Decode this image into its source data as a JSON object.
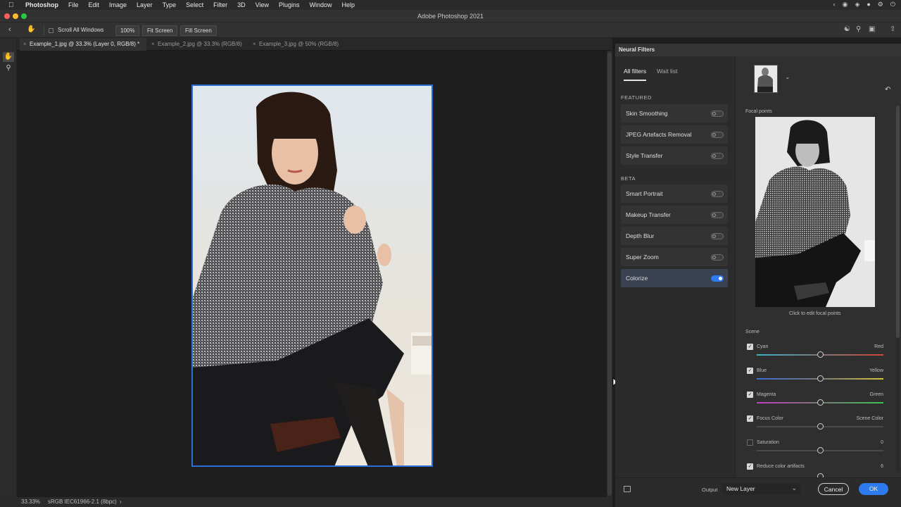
{
  "menubar": {
    "app": "Photoshop",
    "items": [
      "File",
      "Edit",
      "Image",
      "Layer",
      "Type",
      "Select",
      "Filter",
      "3D",
      "View",
      "Plugins",
      "Window",
      "Help"
    ]
  },
  "window": {
    "title": "Adobe Photoshop 2021"
  },
  "options": {
    "scroll_all_windows": "Scroll All Windows",
    "zoom_100": "100%",
    "fit_screen": "Fit Screen",
    "fill_screen": "Fill Screen"
  },
  "tabs": [
    {
      "label": "Example_1.jpg @ 33.3% (Layer 0, RGB/8) *"
    },
    {
      "label": "Example_2.jpg @ 33.3% (RGB/8)"
    },
    {
      "label": "Example_3.jpg @ 50% (RGB/8)"
    }
  ],
  "status": {
    "zoom": "33.33%",
    "profile": "sRGB IEC61966-2.1 (8bpc)"
  },
  "neural_filters": {
    "title": "Neural Filters",
    "tab_all": "All filters",
    "tab_wait": "Wait list",
    "featured_heading": "FEATURED",
    "beta_heading": "BETA",
    "featured": [
      {
        "label": "Skin Smoothing",
        "on": false
      },
      {
        "label": "JPEG Artefacts Removal",
        "on": false
      },
      {
        "label": "Style Transfer",
        "on": false
      }
    ],
    "beta": [
      {
        "label": "Smart Portrait",
        "on": false
      },
      {
        "label": "Makeup Transfer",
        "on": false
      },
      {
        "label": "Depth Blur",
        "on": false
      },
      {
        "label": "Super Zoom",
        "on": false
      },
      {
        "label": "Colorize",
        "on": true
      }
    ],
    "focal_points_label": "Focal points",
    "focal_hint": "Click to edit focal points",
    "scene_label": "Scene",
    "sliders": [
      {
        "label": "Cyan",
        "right": "Red",
        "checked": true,
        "value": 0.5
      },
      {
        "label": "Blue",
        "right": "Yellow",
        "checked": true,
        "value": 0.5
      },
      {
        "label": "Magenta",
        "right": "Green",
        "checked": true,
        "value": 0.5
      },
      {
        "label": "Focus Color",
        "right": "Scene Color",
        "checked": true,
        "value": 0.5
      },
      {
        "label": "Saturation",
        "right": "0",
        "checked": false,
        "value": 0.5
      },
      {
        "label": "Reduce color artifacts",
        "right": "6",
        "checked": true,
        "value": 0.5
      }
    ],
    "output_label": "Output",
    "output_value": "New Layer",
    "cancel": "Cancel",
    "ok": "OK"
  },
  "colors": {
    "accent": "#2d7bee",
    "selection": "#2b6fd6"
  }
}
